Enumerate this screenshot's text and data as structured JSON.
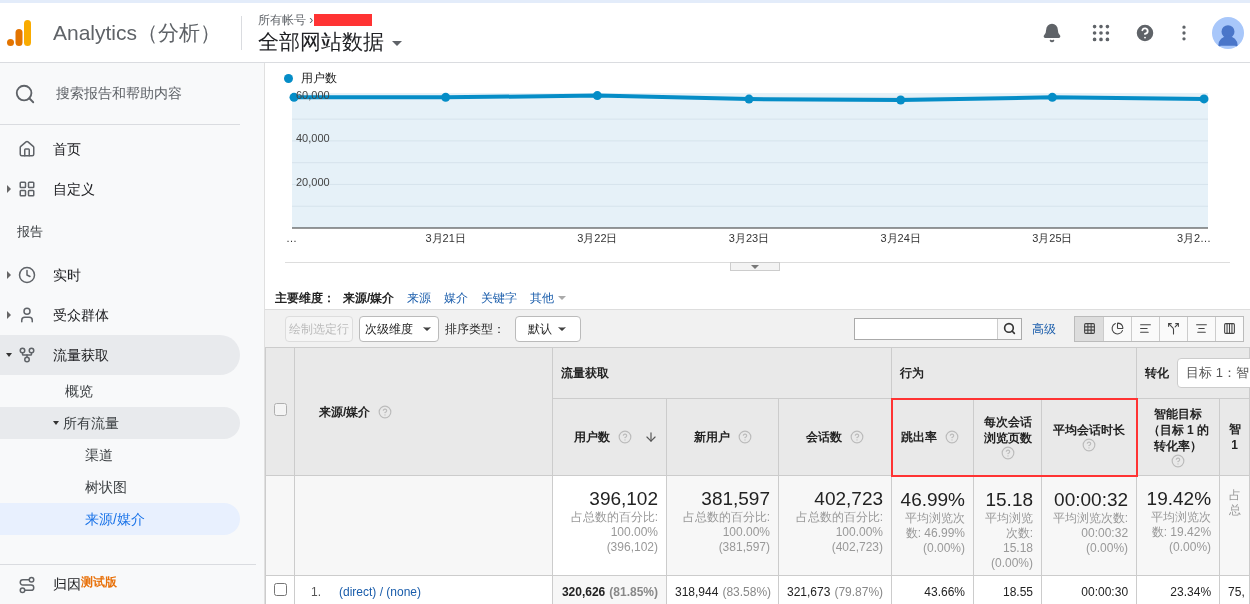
{
  "header": {
    "app_name": "Analytics（分析）",
    "breadcrumb": "所有帐号 ›",
    "view": "全部网站数据"
  },
  "sidebar": {
    "search": {
      "placeholder": "搜索报告和帮助内容"
    },
    "items": [
      {
        "kind": "link",
        "label": "首页",
        "selected": false
      },
      {
        "kind": "link",
        "label": "自定义",
        "selected": false,
        "expanded": false
      },
      {
        "kind": "section",
        "label": "报告"
      },
      {
        "kind": "link",
        "label": "实时",
        "selected": false,
        "expanded": false
      },
      {
        "kind": "link",
        "label": "受众群体",
        "selected": false,
        "expanded": false
      },
      {
        "kind": "link",
        "label": "流量获取",
        "selected": false,
        "expanded": true,
        "children": [
          {
            "label": "概览",
            "selected": false
          },
          {
            "label": "所有流量",
            "selected": false,
            "expanded": true,
            "children": [
              {
                "label": "渠道",
                "selected": false
              },
              {
                "label": "树状图",
                "selected": false
              },
              {
                "label": "来源/媒介",
                "selected": true
              }
            ]
          }
        ]
      }
    ],
    "footer": {
      "label": "归因",
      "badge": "测试版"
    }
  },
  "chart": {
    "chart_data": {
      "type": "line",
      "grid": true,
      "categories": [
        "…",
        "3月21日",
        "3月22日",
        "3月23日",
        "3月24日",
        "3月25日",
        "3月2…"
      ],
      "yticks": [
        {
          "value": 20000,
          "label": "20,000"
        },
        {
          "value": 40000,
          "label": "40,000"
        },
        {
          "value": 60000,
          "label": "60,000"
        }
      ],
      "ylim": [
        0,
        62000
      ],
      "series": [
        {
          "name": "用户数",
          "color": "#058dc7",
          "marker": true,
          "values": [
            60000,
            60000,
            60800,
            59200,
            58800,
            60000,
            59300
          ]
        }
      ]
    }
  },
  "dimensions": {
    "label": "主要维度：",
    "options": [
      {
        "label": "来源/媒介",
        "selected": true
      },
      {
        "label": "来源",
        "selected": false
      },
      {
        "label": "媒介",
        "selected": false
      },
      {
        "label": "关键字",
        "selected": false
      },
      {
        "label": "其他",
        "selected": false,
        "menu": true
      }
    ]
  },
  "toolbar": {
    "plot_rows": {
      "label": "绘制选定行",
      "disabled": true
    },
    "secondary": "次级维度",
    "sort_label": "排序类型：",
    "sort": "默认",
    "advanced": "高级",
    "views": [
      {
        "selected": true
      },
      {
        "selected": false
      },
      {
        "selected": false
      },
      {
        "selected": false
      },
      {
        "selected": false
      },
      {
        "selected": false
      }
    ]
  },
  "table": {
    "dimension_header": "来源/媒介",
    "header_checked": false,
    "groups": [
      {
        "label": "流量获取"
      },
      {
        "label": "行为"
      },
      {
        "label": "转化",
        "select": "目标 1：智"
      }
    ],
    "columns": [
      {
        "label": "用户数",
        "sorted": true,
        "highlighted": false
      },
      {
        "label": "新用户",
        "sorted": false,
        "highlighted": false
      },
      {
        "label": "会话数",
        "sorted": false,
        "highlighted": false
      },
      {
        "label": "跳出率",
        "sorted": false,
        "highlighted": true
      },
      {
        "label": "每次会话浏览页数",
        "sorted": false,
        "highlighted": true
      },
      {
        "label": "平均会话时长",
        "sorted": false,
        "highlighted": true
      },
      {
        "label": "智能目标（目标 1 的转化率）",
        "sorted": false,
        "highlighted": false
      },
      {
        "label": "智\n1",
        "sorted": false,
        "highlighted": false
      }
    ],
    "summary": [
      {
        "value": "396,102",
        "detail": "占总数的百分比:\n100.00%\n(396,102)"
      },
      {
        "value": "381,597",
        "detail": "占总数的百分比:\n100.00%\n(381,597)"
      },
      {
        "value": "402,723",
        "detail": "占总数的百分比:\n100.00%\n(402,723)"
      },
      {
        "value": "46.99%",
        "detail": "平均浏览次数: 46.99%\n(0.00%)"
      },
      {
        "value": "15.18",
        "detail": "平均浏览次数: 15.18\n(0.00%)"
      },
      {
        "value": "00:00:32",
        "detail": "平均浏览次数:\n00:00:32\n(0.00%)"
      },
      {
        "value": "19.42%",
        "detail": "平均浏览次数: 19.42%\n(0.00%)"
      },
      {
        "detail": "占总"
      }
    ],
    "rows": [
      {
        "index": "1.",
        "source": "(direct) / (none)",
        "checked": false,
        "cells": [
          {
            "value": "320,626",
            "pct": "(81.85%)"
          },
          {
            "value": "318,944",
            "pct": "(83.58%)"
          },
          {
            "value": "321,673",
            "pct": "(79.87%)"
          },
          {
            "value": "43.66%"
          },
          {
            "value": "18.55"
          },
          {
            "value": "00:00:30"
          },
          {
            "value": "23.34%"
          },
          {
            "value": "75,"
          }
        ]
      }
    ]
  }
}
